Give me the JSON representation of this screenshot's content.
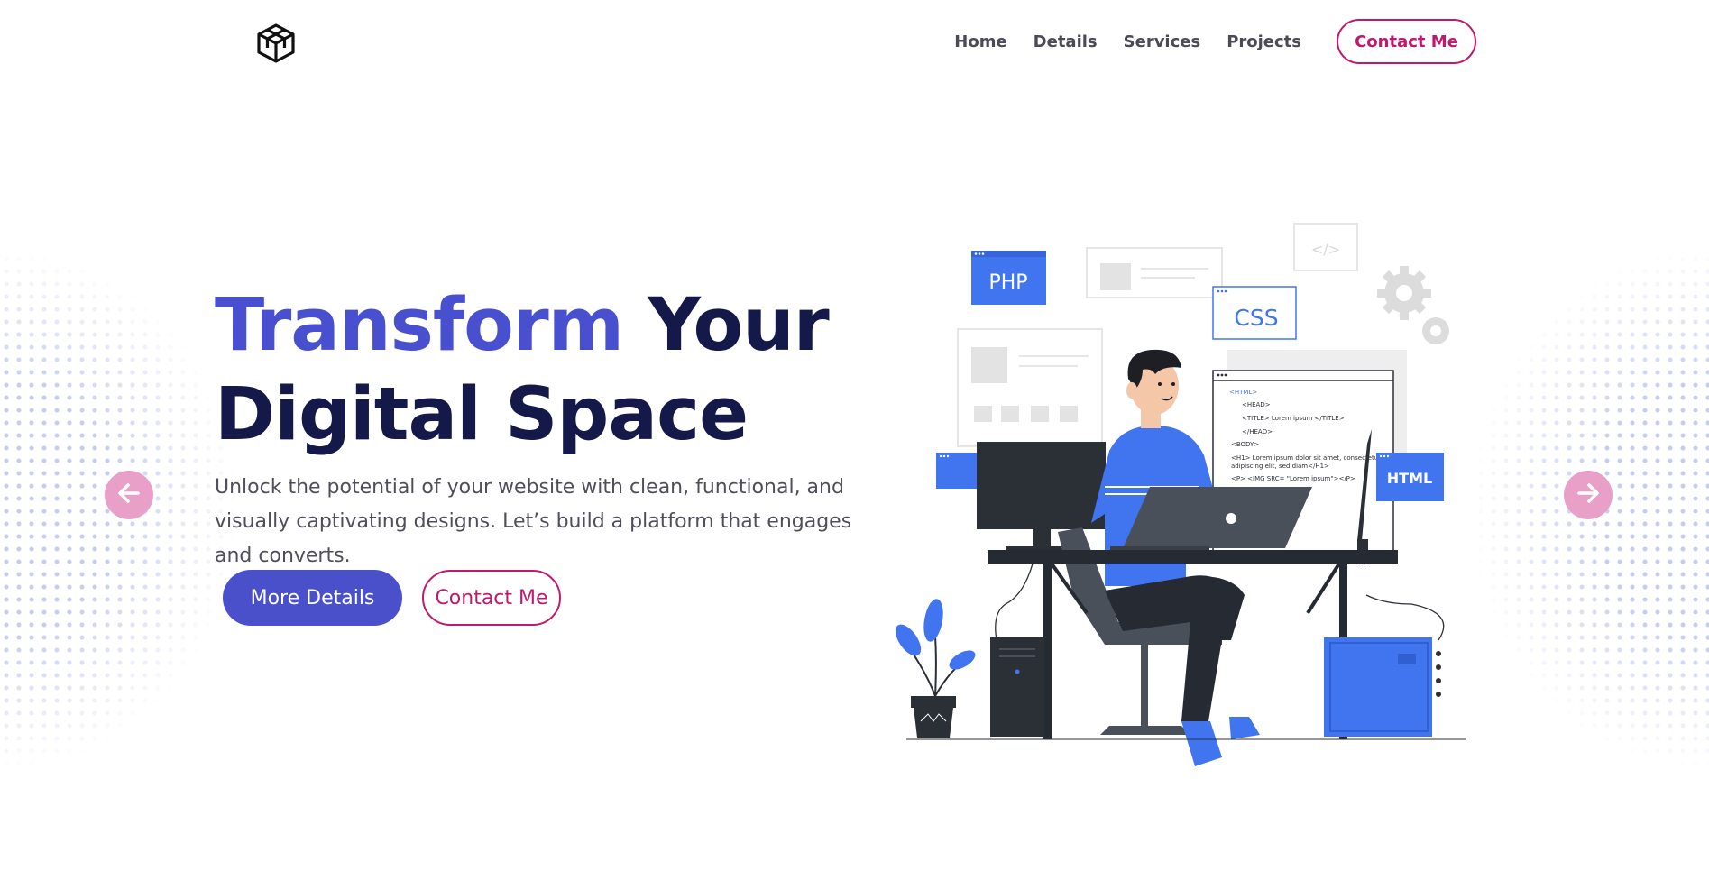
{
  "header": {
    "logo_icon": "cube-logo-icon",
    "nav": {
      "items": [
        {
          "label": "Home"
        },
        {
          "label": "Details"
        },
        {
          "label": "Services"
        },
        {
          "label": "Projects"
        }
      ],
      "cta_label": "Contact Me"
    }
  },
  "hero": {
    "title_accent": "Transform",
    "title_rest_line1": " Your",
    "title_line2": "Digital Space",
    "description": "Unlock the potential of your website with clean, functional, and visually captivating designs. Let’s build a platform that engages and converts.",
    "primary_button": "More Details",
    "secondary_button": "Contact Me"
  },
  "carousel": {
    "prev_icon": "arrow-left-icon",
    "next_icon": "arrow-right-icon"
  },
  "illustration": {
    "badges": {
      "php": "PHP",
      "css": "CSS",
      "html": "HTML"
    },
    "code_lines": [
      "<HTML>",
      "<HEAD>",
      "<TITLE> Lorem ipsum </TITLE>",
      "</HEAD>",
      "<BODY>",
      "<H1> Lorem ipsum dolor sit amet, consectetur",
      "adipiscing elit, sed diam</H1>",
      "<P> <IMG SRC= \"Lorem ipsum\"></P>"
    ]
  },
  "colors": {
    "brand_blue": "#4950cf",
    "dark_navy": "#14194a",
    "accent_magenta": "#c2176e",
    "illustration_blue": "#4175f0",
    "arrow_pink": "#e8a0c8"
  }
}
